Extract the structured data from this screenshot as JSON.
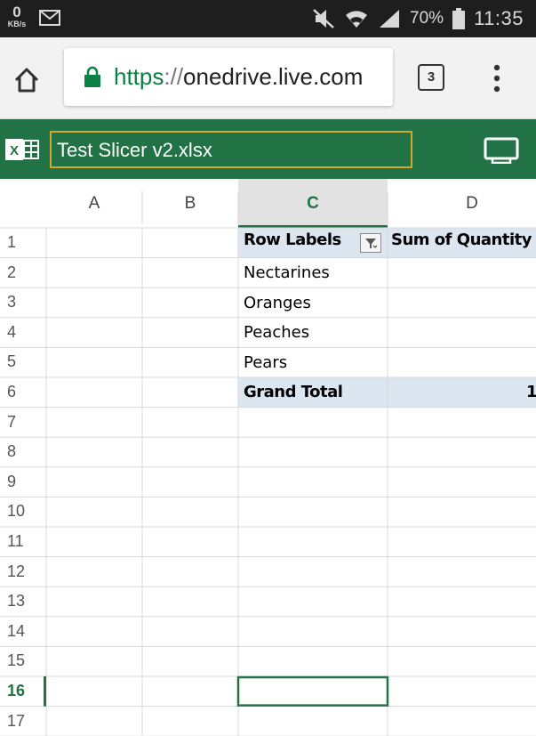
{
  "status_bar": {
    "net_speed_value": "0",
    "net_speed_unit": "KB/s",
    "battery": "70%",
    "time": "11:35",
    "icons": [
      "gmail-icon",
      "mute-icon",
      "wifi-icon",
      "signal-icon",
      "battery-icon"
    ]
  },
  "browser": {
    "url_scheme": "https",
    "url_separator": "://",
    "url_host": "onedrive.live.com",
    "tab_count": "3",
    "icons": [
      "home-icon",
      "lock-icon",
      "tabs-icon",
      "overflow-menu-icon"
    ]
  },
  "excel": {
    "file_name": "Test Slicer v2.xlsx",
    "accent": "#217346",
    "icons": [
      "excel-logo-icon",
      "device-view-icon"
    ]
  },
  "sheet": {
    "columns": [
      "A",
      "B",
      "C",
      "D"
    ],
    "selected_column": "C",
    "rows": [
      "1",
      "2",
      "3",
      "4",
      "5",
      "6",
      "7",
      "8",
      "9",
      "10",
      "11",
      "12",
      "13",
      "14",
      "15",
      "16",
      "17"
    ],
    "selected_row": "16",
    "pivot": {
      "header_row_label": "Row Labels",
      "header_value": "Sum of Quantity",
      "items": [
        "Nectarines",
        "Oranges",
        "Peaches",
        "Pears"
      ],
      "grand_total_label": "Grand Total",
      "grand_total_value": "1",
      "header_fill": "#dce6f1"
    }
  }
}
